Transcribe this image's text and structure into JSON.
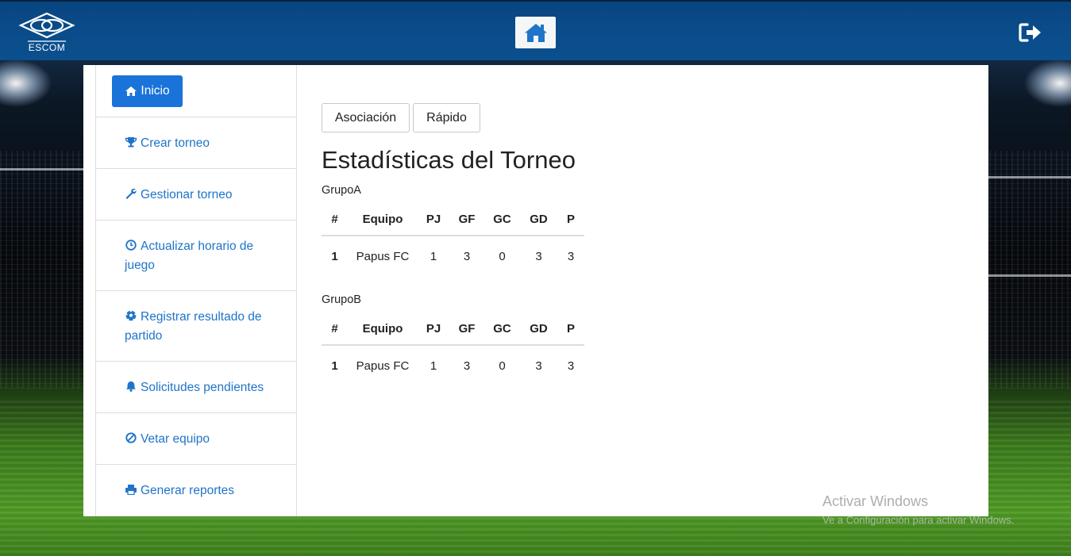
{
  "header": {
    "logo_text": "ESCOM",
    "home_icon": "home-icon",
    "logout_icon": "sign-out-icon"
  },
  "sidebar": {
    "items": [
      {
        "label": "Inicio",
        "icon": "home-icon",
        "active": true
      },
      {
        "label": "Crear torneo",
        "icon": "trophy-icon"
      },
      {
        "label": "Gestionar torneo",
        "icon": "wrench-icon"
      },
      {
        "label": "Actualizar horario de juego",
        "icon": "clock-icon"
      },
      {
        "label": "Registrar resultado de partido",
        "icon": "soccer-ball-icon"
      },
      {
        "label": "Solicitudes pendientes",
        "icon": "bell-icon"
      },
      {
        "label": "Vetar equipo",
        "icon": "ban-icon"
      },
      {
        "label": "Generar reportes",
        "icon": "print-icon"
      }
    ]
  },
  "main": {
    "tabs": [
      {
        "label": "Asociación"
      },
      {
        "label": "Rápido"
      }
    ],
    "title": "Estadísticas del Torneo",
    "columns": [
      "#",
      "Equipo",
      "PJ",
      "GF",
      "GC",
      "GD",
      "P"
    ],
    "groups": [
      {
        "name": "GrupoA",
        "rows": [
          [
            "1",
            "Papus FC",
            "1",
            "3",
            "0",
            "3",
            "3"
          ]
        ]
      },
      {
        "name": "GrupoB",
        "rows": [
          [
            "1",
            "Papus FC",
            "1",
            "3",
            "0",
            "3",
            "3"
          ]
        ]
      }
    ]
  },
  "watermark": {
    "line1": "Activar Windows",
    "line2": "Ve a Configuración para activar Windows."
  },
  "colors": {
    "header": "#0a4d8c",
    "link": "#1f74c9",
    "primary_button": "#1a73d9"
  }
}
